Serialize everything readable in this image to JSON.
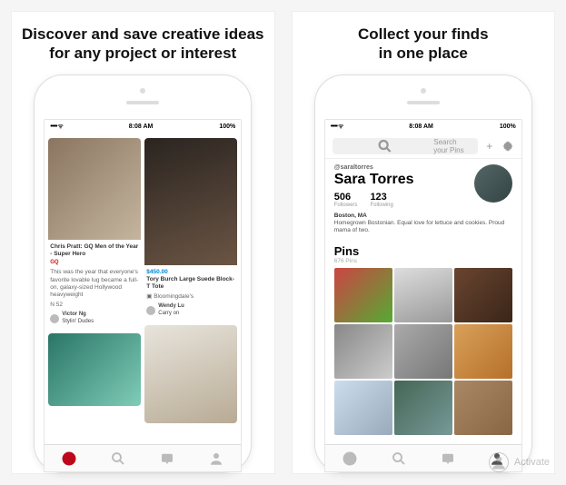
{
  "panels": {
    "left": {
      "headline_l1": "Discover and save creative ideas",
      "headline_l2": "for any project or interest"
    },
    "right": {
      "headline_l1": "Collect your finds",
      "headline_l2": "in one place"
    }
  },
  "status": {
    "time": "8:08 AM",
    "battery": "100%"
  },
  "feed": {
    "pin1": {
      "title": "Chris Pratt: GQ Men of the Year - Super Hero",
      "tag": "GQ",
      "desc": "This was the year that everyone's favorite lovable lug became a full-on, galaxy-sized Hollywood heavyweight",
      "likes": "N 52",
      "user": "Victor Ng",
      "board": "Stylin' Dudes"
    },
    "pin2": {
      "price": "$450.00",
      "title": "Tory Burch Large Suede Block-T Tote",
      "store": "Bloomingdale's",
      "user": "Wendy Lu",
      "board": "Carry on"
    }
  },
  "profile": {
    "search_placeholder": "Search your Pins",
    "handle": "@saraltorres",
    "name": "Sara Torres",
    "followers_n": "506",
    "followers_l": "Followers",
    "following_n": "123",
    "following_l": "Following",
    "location": "Boston, MA",
    "bio": "Homegrown Bostonian. Equal love for lettuce and cookies. Proud mama of two.",
    "section": "Pins",
    "section_sub": "676 Pins"
  },
  "watermark": "Activate"
}
